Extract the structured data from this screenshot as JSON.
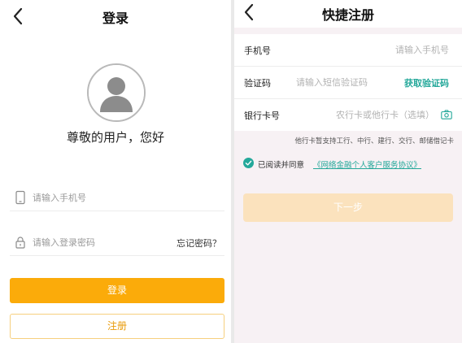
{
  "login": {
    "title": "登录",
    "greeting": "尊敬的用户，您好",
    "phone_placeholder": "请输入手机号",
    "password_placeholder": "请输入登录密码",
    "forgot_label": "忘记密码？",
    "login_label": "登录",
    "register_label": "注册"
  },
  "register": {
    "title": "快捷注册",
    "phone_label": "手机号",
    "phone_placeholder": "请输入手机号",
    "code_label": "验证码",
    "code_placeholder": "请输入短信验证码",
    "get_code_label": "获取验证码",
    "card_label": "银行卡号",
    "card_placeholder": "农行卡或他行卡（选填）",
    "support_note": "他行卡暂支持工行、中行、建行、交行、邮储借记卡",
    "agree_prefix": "已阅读并同意",
    "agree_link": "《网络金融个人客户服务协议》",
    "next_label": "下一步"
  },
  "icons": {
    "back": "chevron-left-icon",
    "avatar": "user-avatar-icon",
    "phone": "mobile-phone-icon",
    "lock": "lock-icon",
    "camera": "camera-icon",
    "check": "check-circle-icon"
  },
  "colors": {
    "primary": "#fbab0a",
    "register_border": "#f6cf7e",
    "link": "#24a89a",
    "next_disabled": "#fbe2bd"
  }
}
